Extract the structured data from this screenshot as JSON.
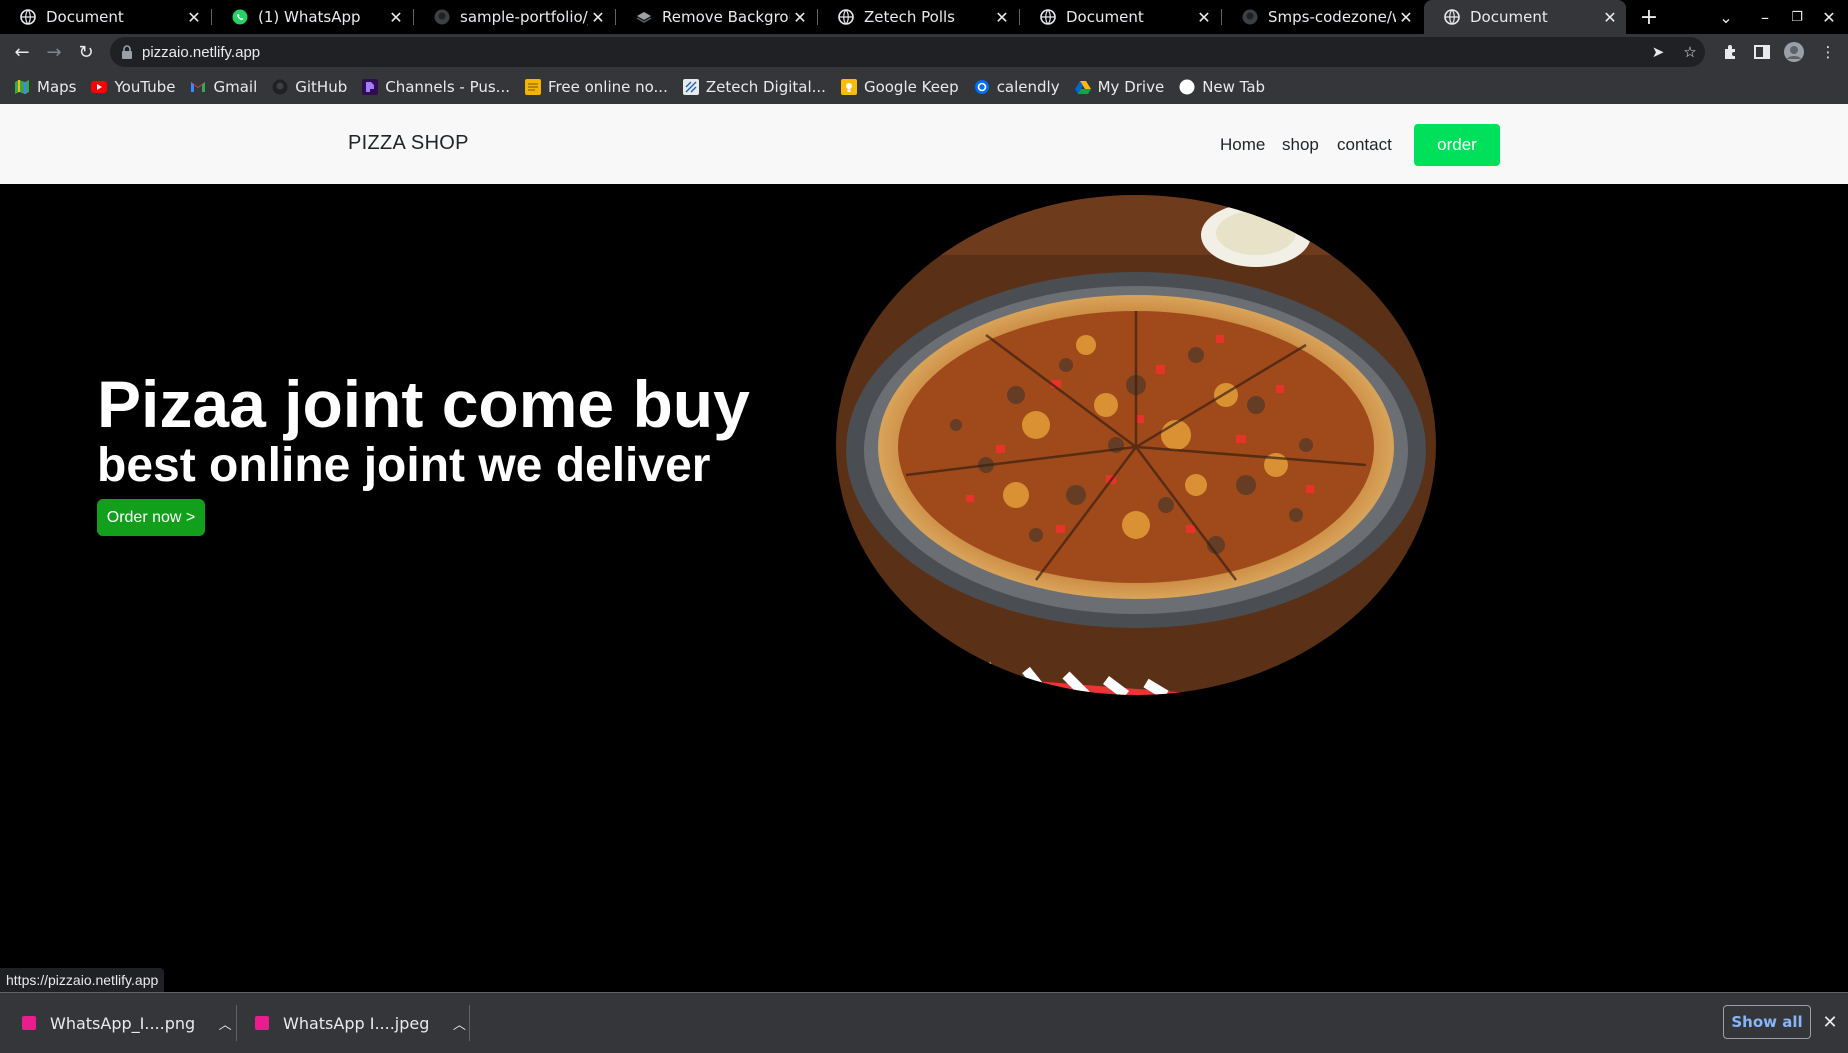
{
  "browser": {
    "tabs": [
      {
        "title": "Document",
        "favicon": "globe-icon",
        "active": false
      },
      {
        "title": "(1) WhatsApp",
        "favicon": "whatsapp-icon",
        "active": false
      },
      {
        "title": "sample-portfolio/_b",
        "favicon": "github-icon",
        "active": false
      },
      {
        "title": "Remove Backgrounc",
        "favicon": "removebg-icon",
        "active": false
      },
      {
        "title": "Zetech Polls",
        "favicon": "globe-icon",
        "active": false
      },
      {
        "title": "Document",
        "favicon": "globe-icon",
        "active": false
      },
      {
        "title": "Smps-codezone/we",
        "favicon": "github-icon",
        "active": false
      },
      {
        "title": "Document",
        "favicon": "globe-icon",
        "active": true
      }
    ],
    "url": "pizzaio.netlify.app",
    "bookmarks": [
      {
        "label": "Maps",
        "icon": "maps-icon",
        "color": "#34a853"
      },
      {
        "label": "YouTube",
        "icon": "youtube-icon",
        "color": "#ff0000"
      },
      {
        "label": "Gmail",
        "icon": "gmail-icon",
        "color": "#ea4335"
      },
      {
        "label": "GitHub",
        "icon": "github-icon",
        "color": "#24292e"
      },
      {
        "label": "Channels - Pus...",
        "icon": "channels-icon",
        "color": "#300d4f"
      },
      {
        "label": "Free online no...",
        "icon": "notes-icon",
        "color": "#f4b400"
      },
      {
        "label": "Zetech Digital...",
        "icon": "zetech-icon",
        "color": "#e8eaed"
      },
      {
        "label": "Google Keep",
        "icon": "keep-icon",
        "color": "#fbbc04"
      },
      {
        "label": "calendly",
        "icon": "calendly-icon",
        "color": "#006bff"
      },
      {
        "label": "My Drive",
        "icon": "drive-icon",
        "color": "#1fa463"
      },
      {
        "label": "New Tab",
        "icon": "newtab-icon",
        "color": "#ffffff"
      }
    ],
    "status_url": "https://pizzaio.netlify.app"
  },
  "site": {
    "brand": "PIZZA SHOP",
    "nav": {
      "home": "Home",
      "shop": "shop",
      "contact": "contact",
      "order": "order"
    },
    "hero": {
      "heading": "Pizaa joint come buy",
      "subheading": "best online joint we deliver",
      "cta": "Order now >"
    },
    "colors": {
      "order_button": "#00e05a",
      "cta_button": "#12a01c",
      "background": "#000000",
      "navbar": "#f8f8f8"
    }
  },
  "downloads": {
    "items": [
      {
        "name": "WhatsApp_I....png"
      },
      {
        "name": "WhatsApp I....jpeg"
      }
    ],
    "show_all": "Show all"
  }
}
